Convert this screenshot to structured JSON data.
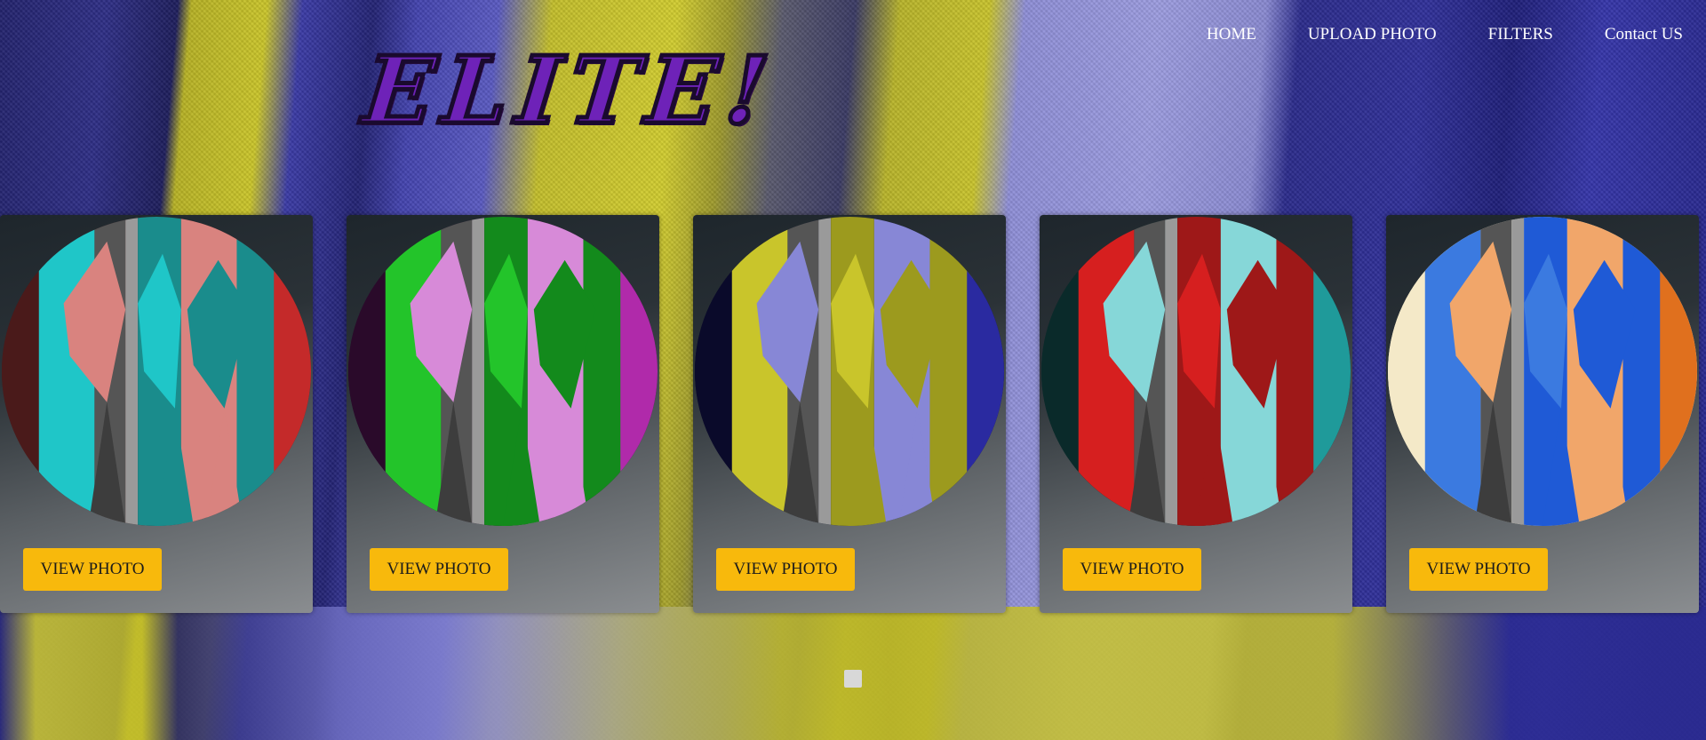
{
  "site": {
    "logo_text": "ELITE!"
  },
  "nav": {
    "items": [
      {
        "label": "HOME"
      },
      {
        "label": "UPLOAD PHOTO"
      },
      {
        "label": "FILTERS"
      },
      {
        "label": "Contact US"
      }
    ]
  },
  "cards": [
    {
      "button_label": "VIEW PHOTO",
      "colors": [
        "#1fc6c8",
        "#d9837f",
        "#1a8c8c",
        "#c42a2a",
        "#4a1a1a"
      ]
    },
    {
      "button_label": "VIEW PHOTO",
      "colors": [
        "#23c42a",
        "#d78ad8",
        "#138a1c",
        "#b02aaa",
        "#2a0a2a"
      ]
    },
    {
      "button_label": "VIEW PHOTO",
      "colors": [
        "#c9c52b",
        "#8787d6",
        "#9c9a1e",
        "#2a2aa0",
        "#0a0a2a"
      ]
    },
    {
      "button_label": "VIEW PHOTO",
      "colors": [
        "#d61f1f",
        "#86d7d8",
        "#9e1818",
        "#1f9a9a",
        "#0a2a2a"
      ]
    },
    {
      "button_label": "VIEW PHOTO",
      "colors": [
        "#3b7ae0",
        "#f1a66a",
        "#1f5ad6",
        "#e0701e",
        "#f4e9c8"
      ]
    }
  ],
  "slider": {
    "indicator_icon": "square-dot-icon"
  }
}
